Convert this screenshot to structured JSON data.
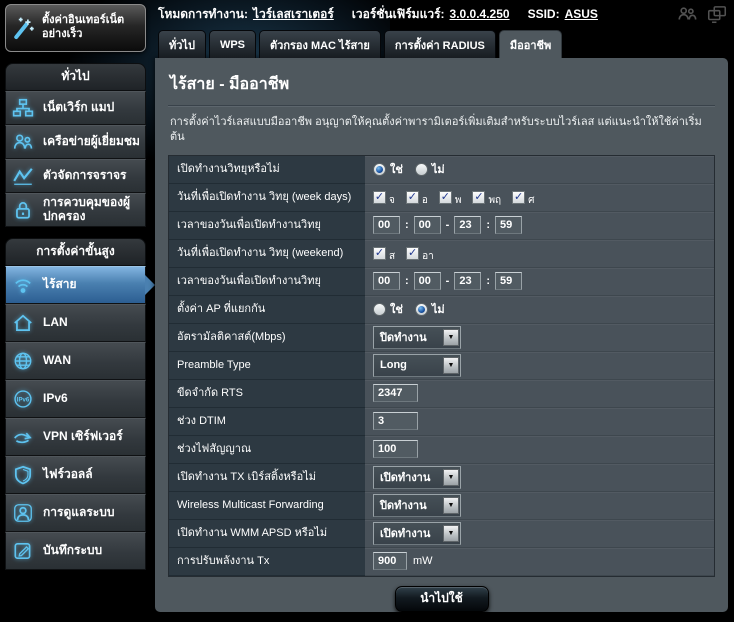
{
  "header": {
    "mode_label": "โหมดการทำงาน:",
    "mode_value": "ไวร์เลสเราเตอร์",
    "firmware_label": "เวอร์ชั่นเฟิร์มแวร์:",
    "firmware_value": "3.0.0.4.250",
    "ssid_label": "SSID:",
    "ssid_value": "ASUS",
    "icons": [
      "clients-icon",
      "devices-icon"
    ]
  },
  "sidebar": {
    "qis_button": "ตั้งค่าอินเทอร์เน็ต อย่างเร็ว",
    "qis_icon": "magic-wand-icon",
    "sections": {
      "general": "ทั่วไป",
      "advanced": "การตั้งค่าขั้นสูง"
    },
    "general_items": [
      {
        "key": "network-map",
        "label": "เน็ตเวิร์ก แมป",
        "icon": "network-map-icon",
        "selected": false
      },
      {
        "key": "guest-network",
        "label": "เครือข่ายผู้เยี่ยมชม",
        "icon": "guest-network-icon",
        "selected": false
      },
      {
        "key": "traffic-manager",
        "label": "ตัวจัดการจราจร",
        "icon": "traffic-manager-icon",
        "selected": false
      },
      {
        "key": "parental-control",
        "label": "การควบคุมของผู้ปกครอง",
        "icon": "parental-control-icon",
        "selected": false
      }
    ],
    "advanced_items": [
      {
        "key": "wireless",
        "label": "ไร้สาย",
        "icon": "wireless-icon",
        "selected": true
      },
      {
        "key": "lan",
        "label": "LAN",
        "icon": "lan-icon",
        "selected": false
      },
      {
        "key": "wan",
        "label": "WAN",
        "icon": "wan-icon",
        "selected": false
      },
      {
        "key": "ipv6",
        "label": "IPv6",
        "icon": "ipv6-icon",
        "selected": false
      },
      {
        "key": "vpn-server",
        "label": "VPN เซิร์ฟเวอร์",
        "icon": "vpn-server-icon",
        "selected": false
      },
      {
        "key": "firewall",
        "label": "ไฟร์วอลล์",
        "icon": "firewall-icon",
        "selected": false
      },
      {
        "key": "administration",
        "label": "การดูแลระบบ",
        "icon": "administration-icon",
        "selected": false
      },
      {
        "key": "system-log",
        "label": "บันทึกระบบ",
        "icon": "system-log-icon",
        "selected": false
      }
    ]
  },
  "tabs": [
    {
      "key": "general",
      "label": "ทั่วไป",
      "active": false
    },
    {
      "key": "wps",
      "label": "WPS",
      "active": false
    },
    {
      "key": "wireless-mac-filter",
      "label": "ตัวกรอง MAC ไร้สาย",
      "active": false
    },
    {
      "key": "radius-setting",
      "label": "การตั้งค่า RADIUS",
      "active": false
    },
    {
      "key": "professional",
      "label": "มืออาชีพ",
      "active": true
    }
  ],
  "main": {
    "title": "ไร้สาย - มืออาชีพ",
    "description": "การตั้งค่าไวร์เลสแบบมืออาชีพ อนุญาตให้คุณตั้งค่าพารามิเตอร์เพิ่มเติมสำหรับระบบไวร์เลส แต่แนะนำให้ใช้ค่าเริ่มต้น",
    "apply_button": "นำไปใช้",
    "rows": [
      {
        "name": "enable-radio",
        "label": "เปิดทำงานวิทยุหรือไม่",
        "control": {
          "type": "radio",
          "options": [
            {
              "key": "yes",
              "label": "ใช่",
              "selected": true
            },
            {
              "key": "no",
              "label": "ไม่",
              "selected": false
            }
          ]
        }
      },
      {
        "name": "radio-date-weekdays",
        "label": "วันที่เพื่อเปิดทำงาน วิทยุ (week days)",
        "control": {
          "type": "checkboxes",
          "options": [
            {
              "key": "mon",
              "label": "จ",
              "checked": true
            },
            {
              "key": "tue",
              "label": "อ",
              "checked": true
            },
            {
              "key": "wed",
              "label": "พ",
              "checked": true
            },
            {
              "key": "thu",
              "label": "พฤ",
              "checked": true
            },
            {
              "key": "fri",
              "label": "ศ",
              "checked": true
            }
          ]
        }
      },
      {
        "name": "radio-time-weekdays",
        "label": "เวลาของวันเพื่อเปิดทำงานวิทยุ",
        "control": {
          "type": "time_range",
          "values": [
            "00",
            "00",
            "23",
            "59"
          ],
          "separators": [
            ":",
            "-",
            ":"
          ]
        }
      },
      {
        "name": "radio-date-weekend",
        "label": "วันที่เพื่อเปิดทำงาน วิทยุ (weekend)",
        "control": {
          "type": "checkboxes",
          "options": [
            {
              "key": "sat",
              "label": "ส",
              "checked": true
            },
            {
              "key": "sun",
              "label": "อา",
              "checked": true
            }
          ]
        }
      },
      {
        "name": "radio-time-weekend",
        "label": "เวลาของวันเพื่อเปิดทำงานวิทยุ",
        "control": {
          "type": "time_range",
          "values": [
            "00",
            "00",
            "23",
            "59"
          ],
          "separators": [
            ":",
            "-",
            ":"
          ]
        }
      },
      {
        "name": "ap-isolated",
        "label": "ตั้งค่า AP ที่แยกกัน",
        "control": {
          "type": "radio",
          "options": [
            {
              "key": "yes",
              "label": "ใช่",
              "selected": false
            },
            {
              "key": "no",
              "label": "ไม่",
              "selected": true
            }
          ]
        }
      },
      {
        "name": "multicast-rate",
        "label": "อัตรามัลติคาสต์(Mbps)",
        "control": {
          "type": "select",
          "value": "ปิดทำงาน"
        }
      },
      {
        "name": "preamble-type",
        "label": "Preamble Type",
        "control": {
          "type": "select",
          "value": "Long"
        }
      },
      {
        "name": "rts-threshold",
        "label": "ขีดจำกัด RTS",
        "control": {
          "type": "text",
          "value": "2347"
        }
      },
      {
        "name": "dtim-interval",
        "label": "ช่วง DTIM",
        "control": {
          "type": "text",
          "value": "3"
        }
      },
      {
        "name": "beacon-interval",
        "label": "ช่วงไฟสัญญาณ",
        "control": {
          "type": "text",
          "value": "100"
        }
      },
      {
        "name": "tx-bursting",
        "label": "เปิดทำงาน TX เบิร์สติ้งหรือไม่",
        "control": {
          "type": "select",
          "value": "เปิดทำงาน"
        }
      },
      {
        "name": "wireless-multicast-forwarding",
        "label": "Wireless Multicast Forwarding",
        "control": {
          "type": "select",
          "value": "ปิดทำงาน"
        }
      },
      {
        "name": "wmm-apsd",
        "label": "เปิดทำงาน WMM APSD หรือไม่",
        "control": {
          "type": "select",
          "value": "เปิดทำงาน"
        }
      },
      {
        "name": "tx-power",
        "label": "การปรับพลังงาน Tx",
        "control": {
          "type": "text",
          "value": "900",
          "suffix": "mW",
          "small": true
        }
      }
    ]
  },
  "colors": {
    "accent_cyan": "#5ec3f0",
    "selected_item_blue": "#4a80b0",
    "panel_bg": "#4f585e",
    "label_cell_bg": "#2d3942",
    "value_cell_bg": "#49525a",
    "check_blue": "#22398f",
    "radio_blue": "#1c55a4",
    "link": "#ffffff"
  }
}
